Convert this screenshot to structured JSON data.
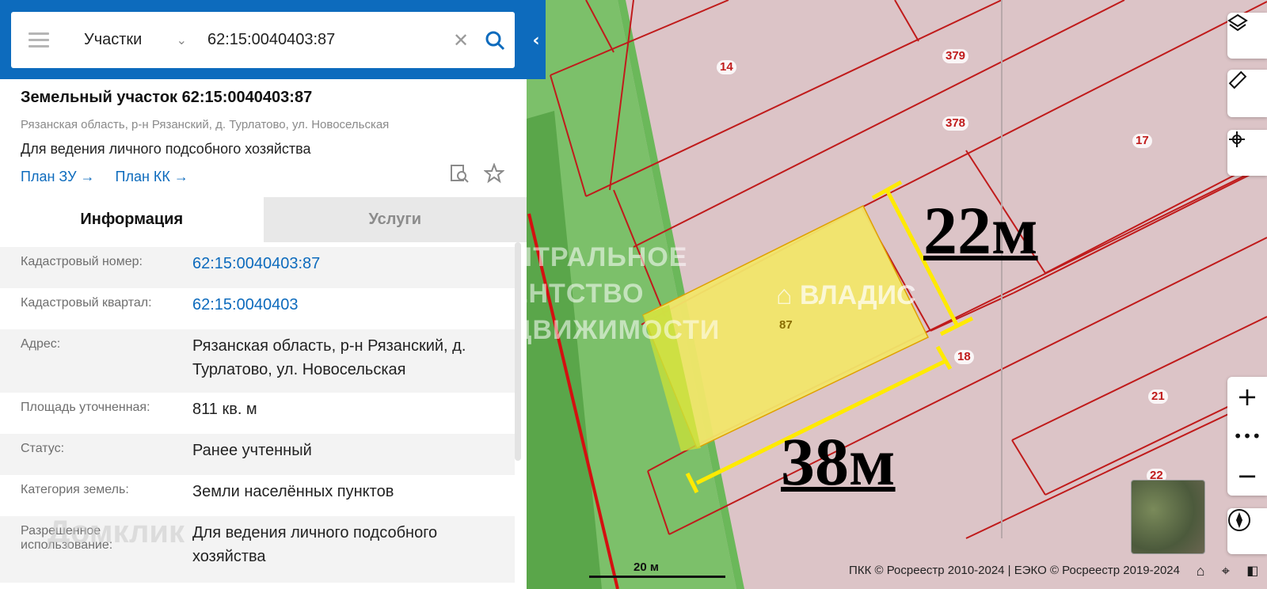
{
  "search": {
    "type_label": "Участки",
    "query": "62:15:0040403:87"
  },
  "parcel": {
    "title": "Земельный участок 62:15:0040403:87",
    "address_short": "Рязанская область, р-н Рязанский, д. Турлатово, ул. Новосельская",
    "purpose": "Для ведения личного подсобного хозяйства",
    "link_plan_zu": "План ЗУ →",
    "link_plan_kk": "План КК →"
  },
  "tabs": [
    {
      "label": "Информация",
      "active": true
    },
    {
      "label": "Услуги",
      "active": false
    }
  ],
  "info_rows": [
    {
      "key": "Кадастровый номер:",
      "value": "62:15:0040403:87",
      "link": true
    },
    {
      "key": "Кадастровый квартал:",
      "value": "62:15:0040403",
      "link": true
    },
    {
      "key": "Адрес:",
      "value": "Рязанская область, р-н Рязанский, д. Турлатово, ул. Новосельская",
      "link": false
    },
    {
      "key": "Площадь уточненная:",
      "value": "811 кв. м",
      "link": false
    },
    {
      "key": "Статус:",
      "value": "Ранее учтенный",
      "link": false
    },
    {
      "key": "Категория земель:",
      "value": "Земли населённых пунктов",
      "link": false
    },
    {
      "key": "Разрешенное использование:",
      "value": "Для ведения личного подсобного хозяйства",
      "link": false
    }
  ],
  "map": {
    "parcel_numbers": [
      "14",
      "379",
      "378",
      "17",
      "87",
      "18",
      "21",
      "22"
    ],
    "measure_width": "22м",
    "measure_length": "38м",
    "scale_label": "20 м",
    "attribution": "ПКК © Росреестр 2010-2024 | ЕЭКО © Росреестр 2019-2024",
    "watermark_agency": [
      "ЦЕНТРАЛЬНОЕ",
      "АГЕНТСТВО",
      "НЕДВИЖИМОСТИ"
    ],
    "watermark_brand": "ВЛАДИС",
    "watermark_domklik": "Домклик"
  },
  "colors": {
    "brand_blue": "#0d6bbd",
    "parcel_red": "#c01b1b",
    "selected_fill": "#f1e66a",
    "measure_yellow": "#ffea00",
    "green_strip": "#7cc06a"
  }
}
